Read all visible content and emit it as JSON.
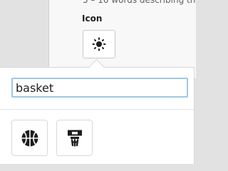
{
  "form": {
    "help_text": "5 – 10 words describing th",
    "icon_label": "Icon",
    "selected_icon": "sun-icon"
  },
  "picker": {
    "search_value": "basket",
    "results": [
      {
        "icon": "basketball-icon"
      },
      {
        "icon": "basketball-hoop-icon"
      }
    ]
  }
}
